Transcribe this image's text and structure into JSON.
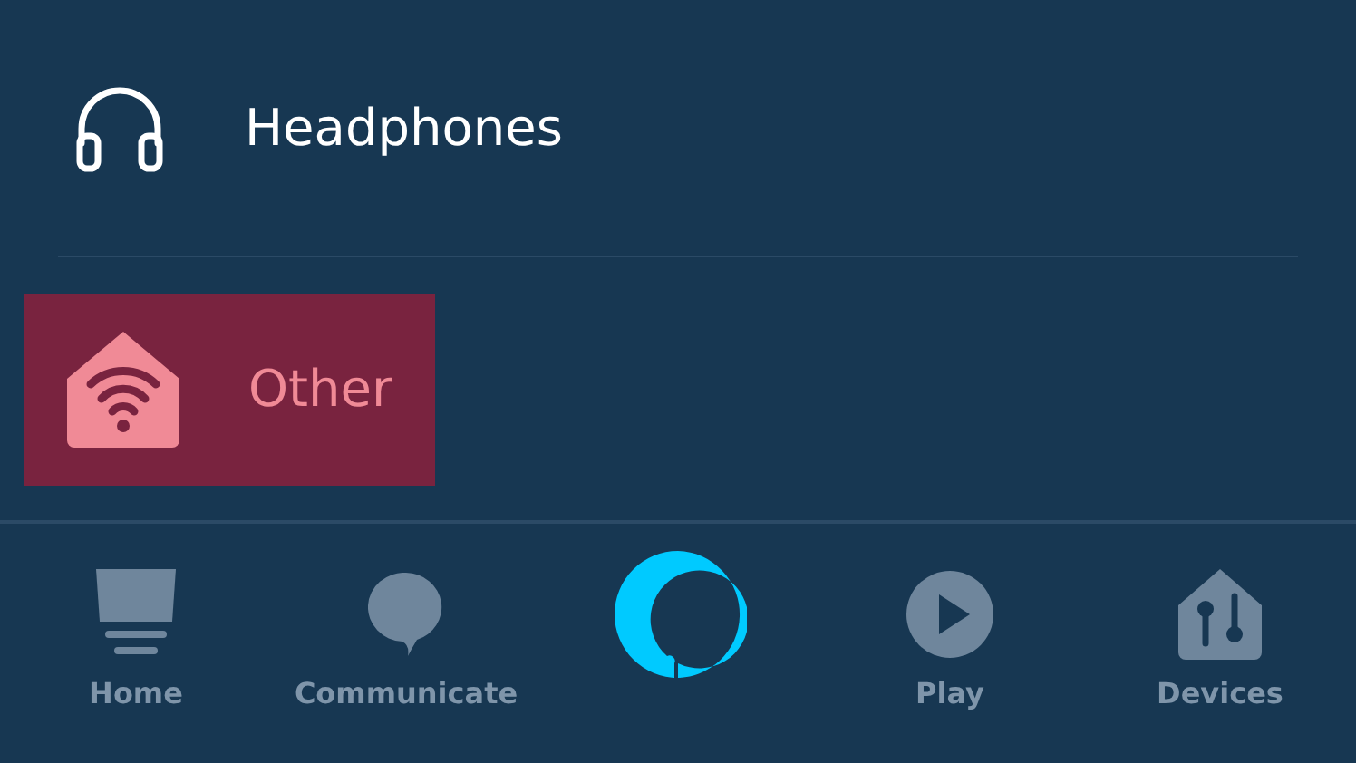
{
  "items": [
    {
      "kind": "headphones",
      "label": "Headphones",
      "selected": false
    },
    {
      "kind": "other",
      "label": "Other",
      "selected": true
    }
  ],
  "nav": [
    {
      "kind": "home",
      "label": "Home"
    },
    {
      "kind": "communicate",
      "label": "Communicate"
    },
    {
      "kind": "alexa"
    },
    {
      "kind": "play",
      "label": "Play"
    },
    {
      "kind": "devices",
      "label": "Devices"
    }
  ]
}
